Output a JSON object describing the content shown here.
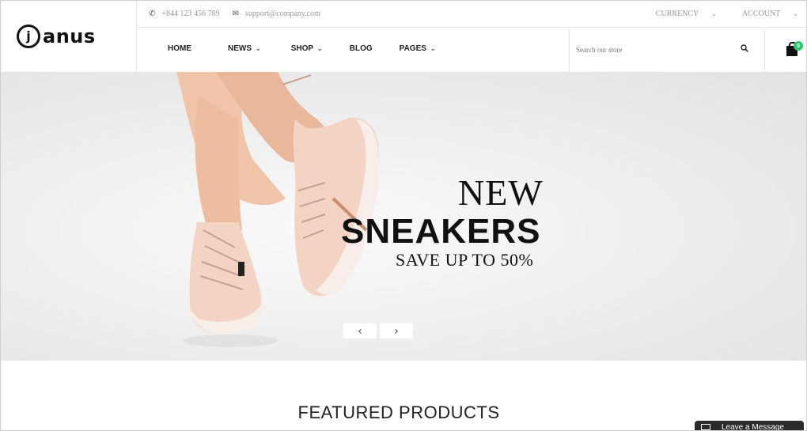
{
  "brand": {
    "logo_mark": "j",
    "name": "anus"
  },
  "topbar": {
    "phone": "+844 123 456 789",
    "email": "support@company.com",
    "currency": "CURRENCY",
    "account": "ACCOUNT"
  },
  "nav": {
    "items": [
      {
        "label": "HOME",
        "has_dropdown": false
      },
      {
        "label": "NEWS",
        "has_dropdown": true
      },
      {
        "label": "SHOP",
        "has_dropdown": true
      },
      {
        "label": "BLOG",
        "has_dropdown": false
      },
      {
        "label": "PAGES",
        "has_dropdown": true
      }
    ]
  },
  "search": {
    "placeholder": "Search our store"
  },
  "cart": {
    "count": "0"
  },
  "hero": {
    "line1": "NEW",
    "line2": "SNEAKERS",
    "line3": "SAVE UP TO 50%",
    "prev_icon": "‹",
    "next_icon": "›"
  },
  "featured": {
    "title": "FEATURED PRODUCTS"
  },
  "chat": {
    "label": "Leave a Message"
  },
  "icons": {
    "phone": "phone-icon",
    "email": "envelope-icon",
    "search": "search-icon",
    "cart": "shopping-bag-icon"
  },
  "colors": {
    "accent": "#2ec46b",
    "text": "#111111",
    "muted": "#999999"
  }
}
